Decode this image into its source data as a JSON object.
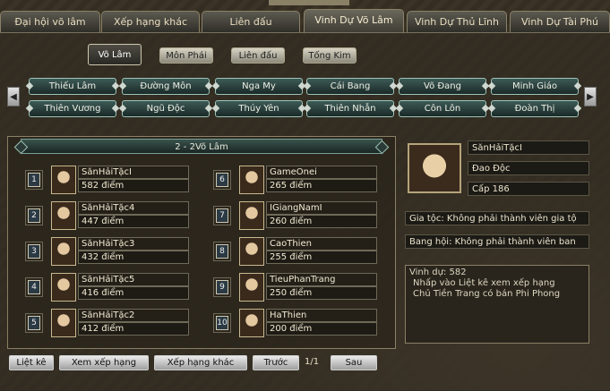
{
  "top_tabs": [
    {
      "label": "Đại hội võ lâm",
      "active": false
    },
    {
      "label": "Xếp hạng khác",
      "active": false
    },
    {
      "label": "Liên đấu",
      "active": false
    },
    {
      "label": "Vinh Dự Võ Lâm",
      "active": true
    },
    {
      "label": "Vinh Dự Thủ Lĩnh",
      "active": false
    },
    {
      "label": "Vinh Dự Tài Phú",
      "active": false
    }
  ],
  "sub_tabs": [
    {
      "label": "Võ Lâm",
      "active": true
    },
    {
      "label": "Môn Phái",
      "active": false
    },
    {
      "label": "Liên đấu",
      "active": false
    },
    {
      "label": "Tống Kim",
      "active": false
    }
  ],
  "nav": {
    "prev": "◀",
    "next": "▶"
  },
  "sects": [
    "Thiếu Lâm",
    "Đường Môn",
    "Nga My",
    "Cái Bang",
    "Võ Đang",
    "Minh Giáo",
    "Thiên Vương",
    "Ngũ Độc",
    "Thúy Yên",
    "Thiên Nhẫn",
    "Côn Lôn",
    "Đoàn Thị"
  ],
  "ranking": {
    "header": "2 - 2Võ Lâm",
    "entries": [
      {
        "rank": "1",
        "name": "SănHảiTặcI",
        "points": "582 điểm"
      },
      {
        "rank": "2",
        "name": "SănHảiTặc4",
        "points": "447 điểm"
      },
      {
        "rank": "3",
        "name": "SănHảiTặc3",
        "points": "432 điểm"
      },
      {
        "rank": "4",
        "name": "SănHảiTặc5",
        "points": "416 điểm"
      },
      {
        "rank": "5",
        "name": "SănHảiTặc2",
        "points": "412 điểm"
      },
      {
        "rank": "6",
        "name": "GameOnei",
        "points": "265 điểm"
      },
      {
        "rank": "7",
        "name": "IGiangNamI",
        "points": "260 điểm"
      },
      {
        "rank": "8",
        "name": "CaoThien",
        "points": "255 điểm"
      },
      {
        "rank": "9",
        "name": "TieuPhanTrang",
        "points": "250 điểm"
      },
      {
        "rank": "10",
        "name": "HaThien",
        "points": "200 điểm"
      }
    ]
  },
  "player": {
    "name": "SănHảiTặcI",
    "sect": "Đao Độc",
    "level": "Cấp 186",
    "family": "Gia tộc: Không phải thành viên gia tộ",
    "guild": "Bang hội: Không phải thành viên ban"
  },
  "honor": {
    "line1": "Vinh dự: 582",
    "line2": "Nhấp vào Liệt kê xem xếp hạng",
    "line3": "Chủ Tiền Trang có bán Phi Phong"
  },
  "bottom": {
    "list": "Liệt kê",
    "view": "Xem xếp hạng",
    "other": "Xếp hạng khác",
    "prev": "Trước",
    "page": "1/1",
    "next": "Sau"
  }
}
